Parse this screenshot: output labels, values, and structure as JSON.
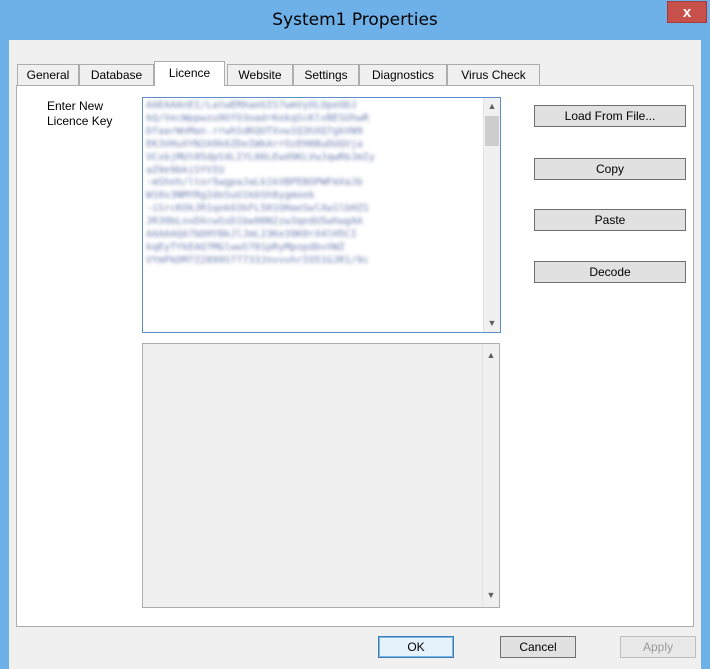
{
  "window": {
    "title": "System1 Properties",
    "close_glyph": "x"
  },
  "tabs": [
    {
      "label": "General"
    },
    {
      "label": "Database"
    },
    {
      "label": "Licence",
      "active": true
    },
    {
      "label": "Website"
    },
    {
      "label": "Settings"
    },
    {
      "label": "Diagnostics"
    },
    {
      "label": "Virus Check"
    }
  ],
  "licence": {
    "key_label": "Enter New Licence Key",
    "key_value_blurred": "AAEAAAnEI/LatwEMXaeGIS7wmVyOLOpeODJ\nkQ/VecWppwzu9OfO3oadrKekqScKlvBESUhwR\nDfaarWnMan.rrwhSdKQUTXvw1Q3hXQ7gkVW9\nEK3VHuXYN2A9k6ZDeIWkArrOzEH0BuDUQVja\nVCxbjMUt05dpS4LIYL06LEwd9KLVwJqwRbJmIy\naZ9e9bkiSYVIU\n-mSheh/ltor5wgpaJaLk1kVBPEBOPWFmXaJb\nW10x3NMYRg2deSuU1kbSh8ygmoek\n-iSrcKOkJR1qokO3kFL501OHaeSwlXw1lbHZS\nJR39bLoxDXcwSxD1bw90N2zw3qedU5whwgAA\nAAAAAQA7bDHYBkJlJmL23Ke39K0rX4lH5CI\nkqEyTYkEAQ7MGlwwS781pRyMpopdbvVWZ\nVYmPkDM7Z2899S77733JnvvvhrIO51GJR1/9c"
  },
  "buttons": {
    "load_from_file": "Load From File...",
    "copy": "Copy",
    "paste": "Paste",
    "decode": "Decode",
    "ok": "OK",
    "cancel": "Cancel",
    "apply": "Apply"
  },
  "colors": {
    "titlebar": "#6eb1e8",
    "close_button": "#c7504b",
    "key_text": "#6d7fb0",
    "focus_border": "#5a8dc9"
  }
}
